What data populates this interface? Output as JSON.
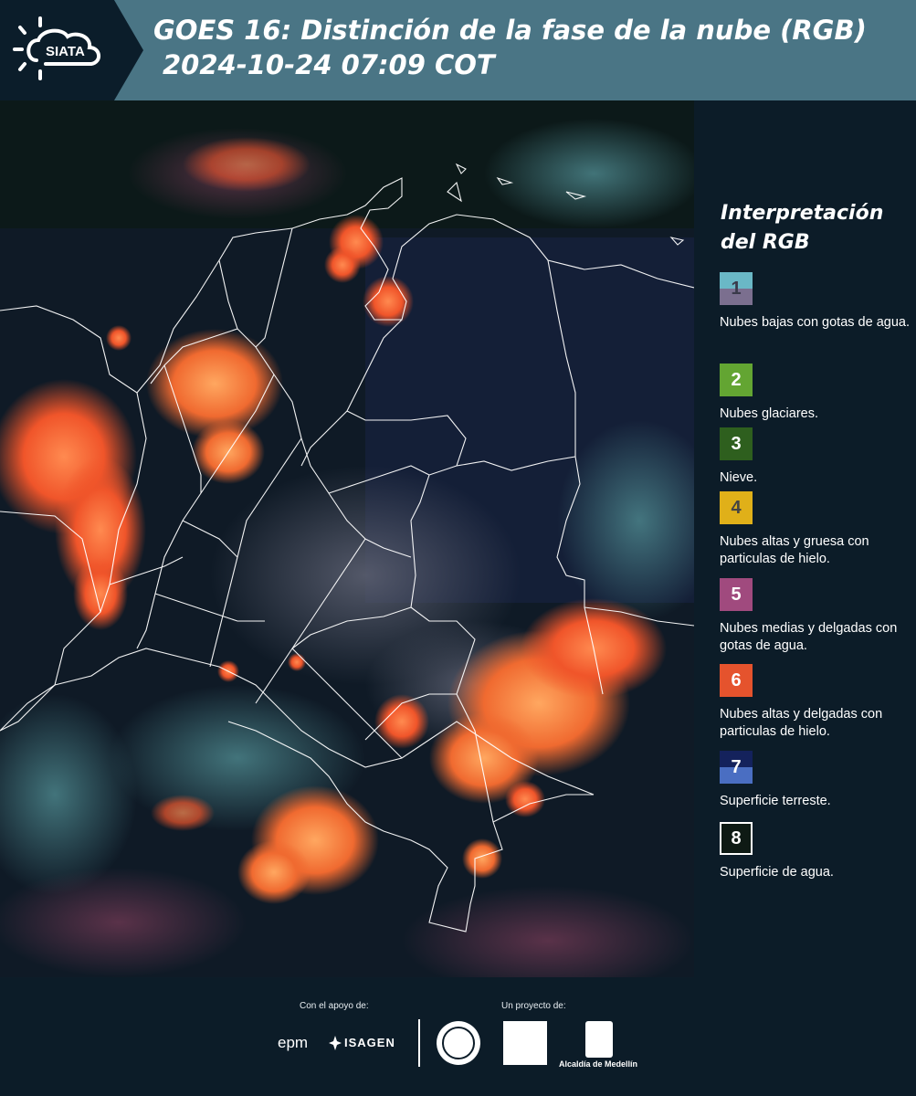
{
  "header": {
    "logo_text": "SIATA",
    "title": "GOES 16: Distinción de la fase de la nube (RGB)",
    "datetime": "2024-10-24 07:09 COT"
  },
  "legend": {
    "title": "Interpretación del RGB",
    "items": [
      {
        "number": "1",
        "label": "Nubes bajas con gotas de agua.",
        "top_color": "#6ab8c6",
        "bottom_color": "#7b6f8f",
        "number_color": "#3a3a4a"
      },
      {
        "number": "2",
        "label": "Nubes glaciares.",
        "top_color": "#63a532",
        "bottom_color": "#63a532",
        "number_color": "#ffffff"
      },
      {
        "number": "3",
        "label": "Nieve.",
        "top_color": "#2e5f1e",
        "bottom_color": "#2e5f1e",
        "number_color": "#ffffff"
      },
      {
        "number": "4",
        "label": "Nubes altas y gruesa con particulas de hielo.",
        "top_color": "#e0b019",
        "bottom_color": "#e0b019",
        "number_color": "#444444"
      },
      {
        "number": "5",
        "label": "Nubes medias y delgadas con gotas de agua.",
        "top_color": "#a04a7e",
        "bottom_color": "#a04a7e",
        "number_color": "#ffffff"
      },
      {
        "number": "6",
        "label": "Nubes altas y delgadas con particulas de hielo.",
        "top_color": "#e5532d",
        "bottom_color": "#e5532d",
        "number_color": "#ffffff"
      },
      {
        "number": "7",
        "label": "Superficie terreste.",
        "top_color": "#14225c",
        "bottom_color": "#4a6ec2",
        "number_color": "#ffffff"
      },
      {
        "number": "8",
        "label": "Superficie de agua.",
        "top_color": "#0e1a14",
        "bottom_color": "#0e1a14",
        "number_color": "#ffffff"
      }
    ]
  },
  "footer": {
    "support_label": "Con el apoyo de:",
    "project_label": "Un proyecto de:",
    "epm_text": "epm",
    "isagen_text": "ISAGEN",
    "alcaldia_text": "Alcaldía de Medellín"
  }
}
